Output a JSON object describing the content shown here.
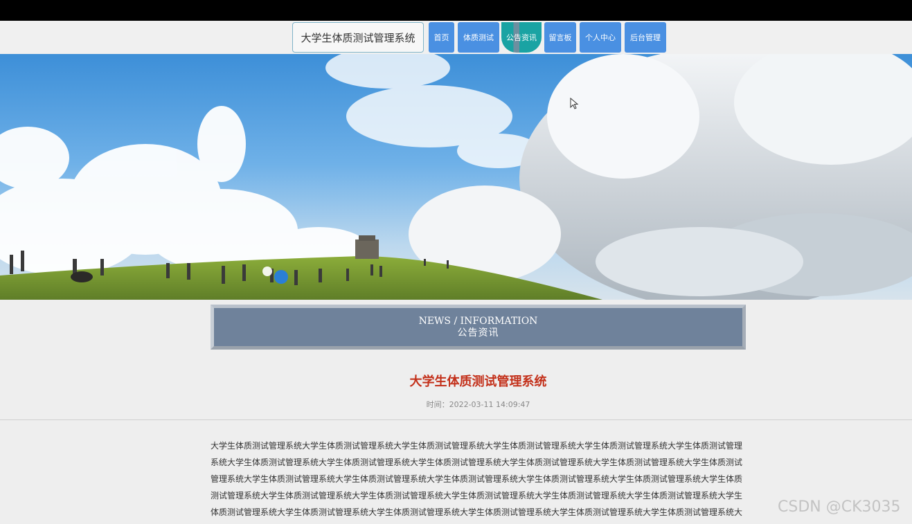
{
  "site_title": "大学生体质测试管理系统",
  "nav": {
    "items": [
      {
        "label": "首页"
      },
      {
        "label": "体质测试"
      },
      {
        "label": "公告资讯",
        "active": true
      },
      {
        "label": "留言板"
      },
      {
        "label": "个人中心"
      },
      {
        "label": "后台管理"
      }
    ]
  },
  "news_header": {
    "en": "NEWS / INFORMATION",
    "cn": "公告资讯"
  },
  "article": {
    "title": "大学生体质测试管理系统",
    "time": "时间：2022-03-11 14:09:47",
    "body": "大学生体质测试管理系统大学生体质测试管理系统大学生体质测试管理系统大学生体质测试管理系统大学生体质测试管理系统大学生体质测试管理系统大学生体质测试管理系统大学生体质测试管理系统大学生体质测试管理系统大学生体质测试管理系统大学生体质测试管理系统大学生体质测试管理系统大学生体质测试管理系统大学生体质测试管理系统大学生体质测试管理系统大学生体质测试管理系统大学生体质测试管理系统大学生体质测试管理系统大学生体质测试管理系统大学生体质测试管理系统大学生体质测试管理系统大学生体质测试管理系统大学生体质测试管理系统大学生体质测试管理系统大学生体质测试管理系统大学生体质测试管理系统大学生体质测试管理系统大学生体质测试管理系统大学生体质测试管理系统大学生体质测试管理系统大学生体质测试管理系统大学生体质测试管理系统大学生体质测试管理系统大学生体质测试管理系统"
  },
  "watermark": "CSDN @CK3035",
  "colors": {
    "nav_button": "#4a90e2",
    "nav_active": "#1aa3a3",
    "article_title": "#c3301a",
    "news_header_bg": "#6f829b"
  },
  "icons": {
    "cursor": "mouse-pointer-icon"
  }
}
